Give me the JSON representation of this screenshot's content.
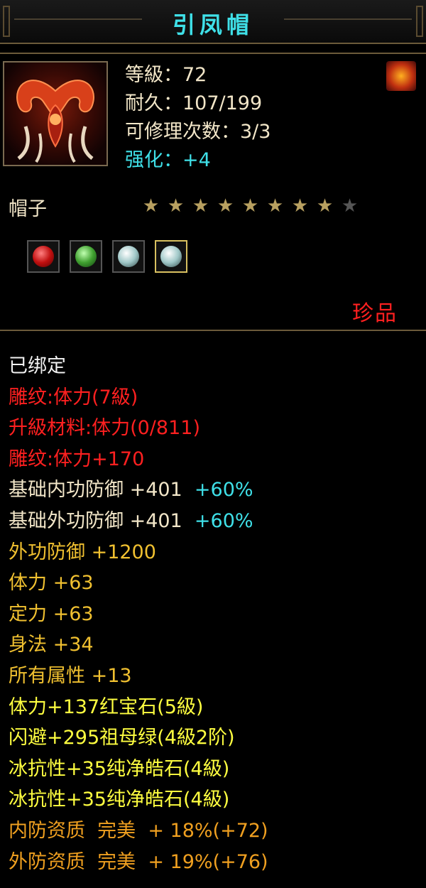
{
  "window": {
    "title": "引凤帽"
  },
  "item": {
    "level": "等級：72",
    "durability": "耐久：107/199",
    "repair": "可修理次数：3/3",
    "enhance": "强化：+4",
    "type": "帽子",
    "stars_filled": 8,
    "stars_total": 9,
    "rarity": "珍品"
  },
  "gems": [
    {
      "icon": "ruby-gem-icon",
      "color": "#c01010"
    },
    {
      "icon": "emerald-gem-icon",
      "color": "#40a030"
    },
    {
      "icon": "diamond-gem-icon",
      "color": "#a0c8c8"
    },
    {
      "icon": "diamond-gem-icon",
      "color": "#a0c8c8",
      "selected": true
    }
  ],
  "attributes": [
    {
      "text": "已绑定",
      "color": "white"
    },
    {
      "text": "雕纹:体力(7級)",
      "color": "red"
    },
    {
      "text": "升級材料:体力(0/811)",
      "color": "red"
    },
    {
      "text": "雕纹:体力+170",
      "color": "red"
    },
    {
      "text": "基础内功防御 +401",
      "extra": "+60%",
      "color": "cream"
    },
    {
      "text": "基础外功防御 +401",
      "extra": "+60%",
      "color": "cream"
    },
    {
      "text": "外功防御 +1200",
      "color": "gold"
    },
    {
      "text": "体力 +63",
      "color": "gold"
    },
    {
      "text": "定力 +63",
      "color": "gold"
    },
    {
      "text": "身法 +34",
      "color": "gold"
    },
    {
      "text": "所有属性 +13",
      "color": "gold"
    },
    {
      "text": "体力+137红宝石(5級)",
      "color": "yellow"
    },
    {
      "text": "闪避+295祖母绿(4級2阶)",
      "color": "yellow"
    },
    {
      "text": "冰抗性+35纯净皓石(4級)",
      "color": "yellow"
    },
    {
      "text": "冰抗性+35纯净皓石(4級)",
      "color": "yellow"
    },
    {
      "text": "内防资质  完美  + 18%(+72)",
      "color": "orange"
    },
    {
      "text": "外防资质  完美  + 19%(+76)",
      "color": "orange"
    }
  ],
  "colors": {
    "title": "#3fe0e8",
    "border": "#6b5a3a",
    "rarity": "#ff2020"
  }
}
